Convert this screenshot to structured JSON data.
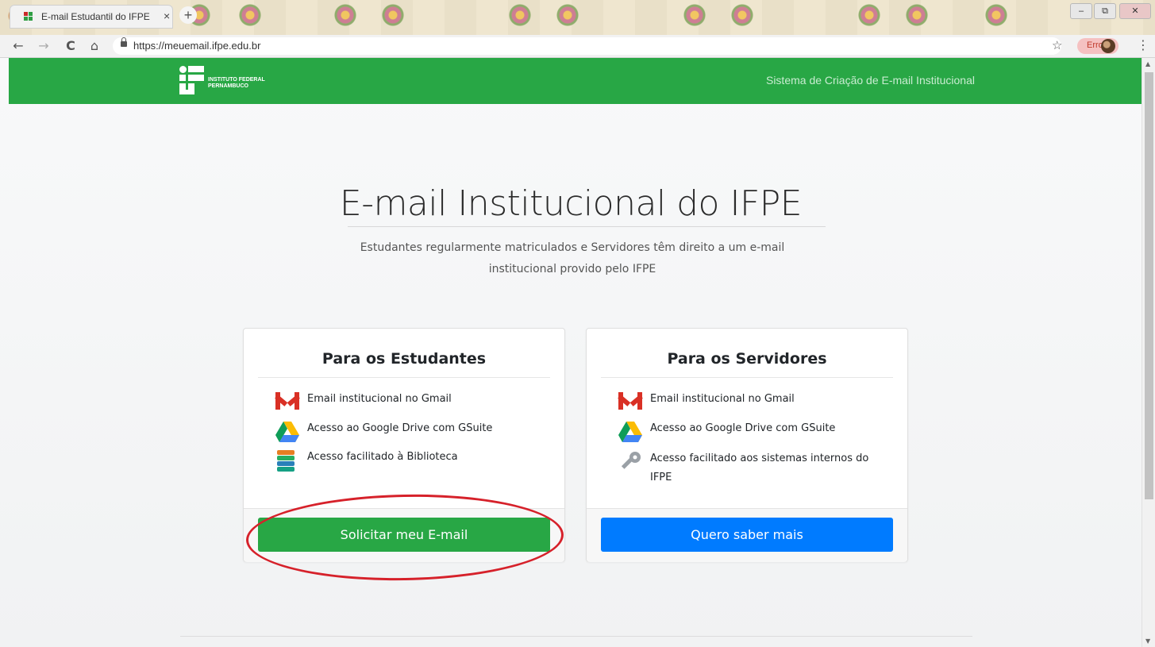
{
  "browser": {
    "tab_title": "E-mail Estudantil do IFPE",
    "tab_close": "×",
    "new_tab": "+",
    "url": "https://meuemail.ifpe.edu.br",
    "back": "←",
    "forward": "→",
    "reload": "C",
    "home": "⌂",
    "star": "☆",
    "profile_label": "Erro",
    "menu": "⋮",
    "win_min": "–",
    "win_max": "⧉",
    "win_close": "✕"
  },
  "site": {
    "logo_line1": "INSTITUTO FEDERAL",
    "logo_line2": "PERNAMBUCO",
    "nav_title": "Sistema de Criação de E-mail Institucional",
    "hero_title": "E-mail Institucional do IFPE",
    "hero_subtitle": "Estudantes regularmente matriculados e Servidores têm direito a um e-mail institucional provido pelo IFPE"
  },
  "cards": [
    {
      "title": "Para os Estudantes",
      "features": [
        {
          "icon": "gmail-icon",
          "label": "Email institucional no Gmail"
        },
        {
          "icon": "google-drive-icon",
          "label": "Acesso ao Google Drive com GSuite"
        },
        {
          "icon": "books-icon",
          "label": "Acesso facilitado à Biblioteca"
        }
      ],
      "button": "Solicitar meu E-mail"
    },
    {
      "title": "Para os Servidores",
      "features": [
        {
          "icon": "gmail-icon",
          "label": "Email institucional no Gmail"
        },
        {
          "icon": "google-drive-icon",
          "label": "Acesso ao Google Drive com GSuite"
        },
        {
          "icon": "key-icon",
          "label": "Acesso facilitado aos sistemas internos do IFPE"
        }
      ],
      "button": "Quero saber mais"
    }
  ],
  "colors": {
    "brand_green": "#28a745",
    "primary_blue": "#007bff",
    "annotation_red": "#d6212a"
  }
}
